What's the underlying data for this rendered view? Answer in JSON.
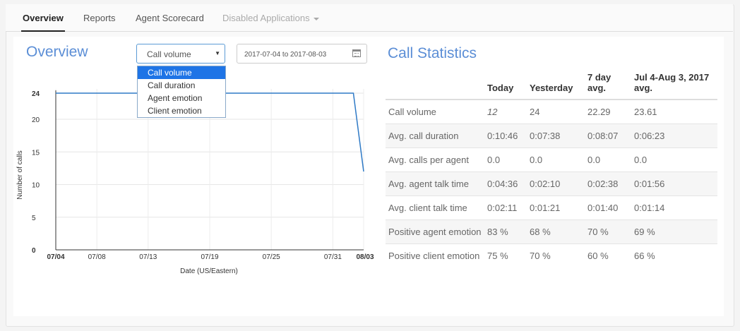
{
  "nav": {
    "items": [
      {
        "label": "Overview"
      },
      {
        "label": "Reports"
      },
      {
        "label": "Agent Scorecard"
      },
      {
        "label": "Disabled Applications"
      }
    ]
  },
  "overview": {
    "title": "Overview",
    "metric_select": {
      "value": "Call volume",
      "options": [
        "Call volume",
        "Call duration",
        "Agent emotion",
        "Client emotion"
      ]
    },
    "date_range": "2017-07-04 to 2017-08-03"
  },
  "chart_data": {
    "type": "line",
    "xlabel": "Date (US/Eastern)",
    "ylabel": "Number of calls",
    "ylim": [
      0,
      24
    ],
    "yticks": [
      0,
      5,
      10,
      15,
      20,
      24
    ],
    "xticks": [
      "07/04",
      "07/08",
      "07/13",
      "07/19",
      "07/25",
      "07/31",
      "08/03"
    ],
    "xtick_days": [
      0,
      4,
      9,
      15,
      21,
      27,
      30
    ],
    "series": [
      {
        "x_days": [
          0,
          29,
          30
        ],
        "values": [
          24,
          24,
          12
        ]
      }
    ],
    "grid": true,
    "color": "#2f7ac6"
  },
  "stats": {
    "title": "Call Statistics",
    "columns": [
      "",
      "Today",
      "Yesterday",
      "7 day avg.",
      "Jul 4-Aug 3, 2017 avg."
    ],
    "rows": [
      [
        "Call volume",
        "12",
        "24",
        "22.29",
        "23.61"
      ],
      [
        "Avg. call duration",
        "0:10:46",
        "0:07:38",
        "0:08:07",
        "0:06:23"
      ],
      [
        "Avg. calls per agent",
        "0.0",
        "0.0",
        "0.0",
        "0.0"
      ],
      [
        "Avg. agent talk time",
        "0:04:36",
        "0:02:10",
        "0:02:38",
        "0:01:56"
      ],
      [
        "Avg. client talk time",
        "0:02:11",
        "0:01:21",
        "0:01:40",
        "0:01:14"
      ],
      [
        "Positive agent emotion",
        "83 %",
        "68 %",
        "70 %",
        "69 %"
      ],
      [
        "Positive client emotion",
        "75 %",
        "70 %",
        "60 %",
        "66 %"
      ]
    ]
  }
}
